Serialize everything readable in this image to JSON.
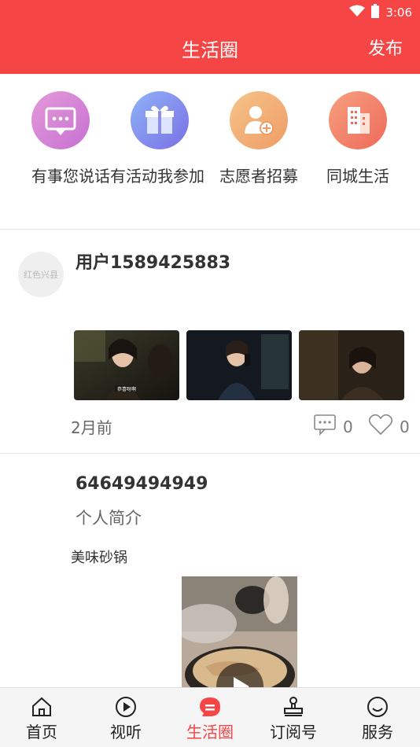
{
  "status": {
    "time": "3:06"
  },
  "header": {
    "title": "生活圈",
    "action_label": "发布"
  },
  "quick_actions": [
    {
      "label": "有事您说话",
      "icon": "chat-bubble-icon",
      "color_from": "#e49ad8",
      "color_to": "#c771d3"
    },
    {
      "label": "有活动我参加",
      "icon": "gift-icon",
      "color_from": "#8fb2f7",
      "color_to": "#7a70e6"
    },
    {
      "label": "志愿者招募",
      "icon": "add-user-icon",
      "color_from": "#f6c489",
      "color_to": "#ee9c66"
    },
    {
      "label": "同城生活",
      "icon": "building-icon",
      "color_from": "#f7a080",
      "color_to": "#ee6a5a"
    }
  ],
  "posts": [
    {
      "username": "用户1589425883",
      "avatar_text": "红色兴县",
      "time": "2月前",
      "comments": "0",
      "likes": "0",
      "image_captions": [
        "恭喜呀啊"
      ]
    },
    {
      "username": "64649494949",
      "bio": "个人简介",
      "content": "美味砂锅"
    }
  ],
  "tabs": [
    {
      "label": "首页",
      "icon": "home-icon"
    },
    {
      "label": "视听",
      "icon": "play-circle-icon"
    },
    {
      "label": "生活圈",
      "icon": "life-circle-icon",
      "active": true
    },
    {
      "label": "订阅号",
      "icon": "stamp-icon"
    },
    {
      "label": "服务",
      "icon": "smile-icon"
    }
  ],
  "colors": {
    "primary": "#f64545",
    "text": "#333333",
    "muted": "#777777"
  }
}
